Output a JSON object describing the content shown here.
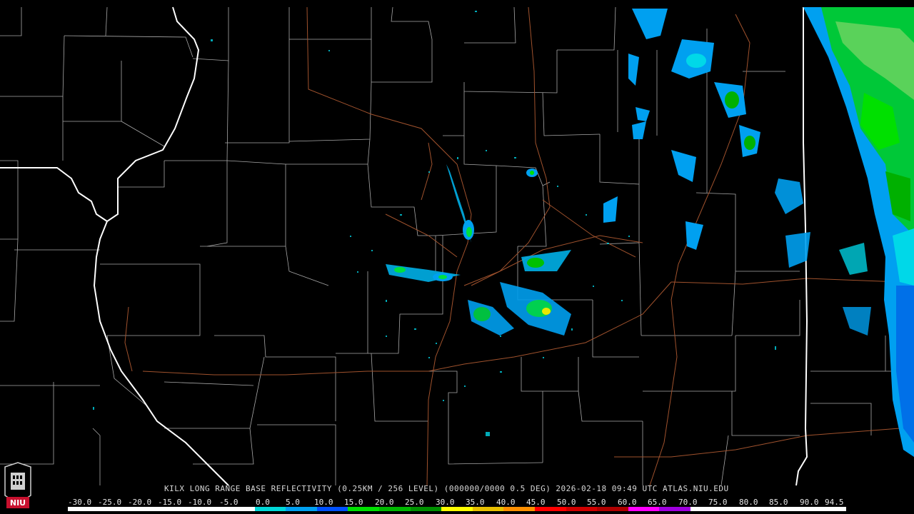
{
  "caption": "KILX LONG RANGE BASE REFLECTIVITY (0.25KM / 256 LEVEL) (000000/0000 0.5 DEG) 2026-02-18 09:49 UTC  ATLAS.NIU.EDU",
  "logo_text": "NIU",
  "scale_labels": [
    "-30.0",
    "-25.0",
    "-20.0",
    "-15.0",
    "-10.0",
    "-5.0",
    "0.0",
    "5.0",
    "10.0",
    "15.0",
    "20.0",
    "25.0",
    "30.0",
    "35.0",
    "40.0",
    "45.0",
    "50.0",
    "55.0",
    "60.0",
    "65.0",
    "70.0",
    "75.0",
    "80.0",
    "85.0",
    "90.0",
    "94.5"
  ],
  "scale_colors": [
    "#ffffff",
    "#ffffff",
    "#ffffff",
    "#ffffff",
    "#ffffff",
    "#ffffff",
    "#00d8d8",
    "#00a0f0",
    "#0050ff",
    "#00e000",
    "#00b800",
    "#009000",
    "#ffff00",
    "#e8c000",
    "#ff9000",
    "#ff0000",
    "#d00000",
    "#b00000",
    "#ff00ff",
    "#a000e0",
    "#ffffff",
    "#ffffff",
    "#ffffff",
    "#ffffff",
    "#ffffff"
  ],
  "colors": {
    "background": "#000000",
    "county_lines": "#b0b0b0",
    "state_lines": "#ffffff",
    "highways": "#a0522d"
  }
}
